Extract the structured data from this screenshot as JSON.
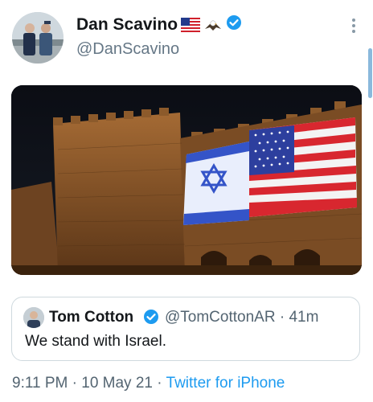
{
  "author": {
    "display_name": "Dan Scavino",
    "handle": "@DanScavino",
    "name_icons": [
      "us-flag-icon",
      "eagle-icon"
    ]
  },
  "media": {
    "icon": "photo"
  },
  "quoted_tweet": {
    "display_name": "Tom Cotton",
    "handle": "@TomCottonAR",
    "separator": "·",
    "age": "41m",
    "text": "We stand with Israel."
  },
  "meta": {
    "time": "9:11 PM",
    "separator1": "·",
    "date": "10 May 21",
    "separator2": "·",
    "source": "Twitter for iPhone"
  },
  "colors": {
    "accent": "#1d9bf0",
    "muted": "#536471"
  }
}
